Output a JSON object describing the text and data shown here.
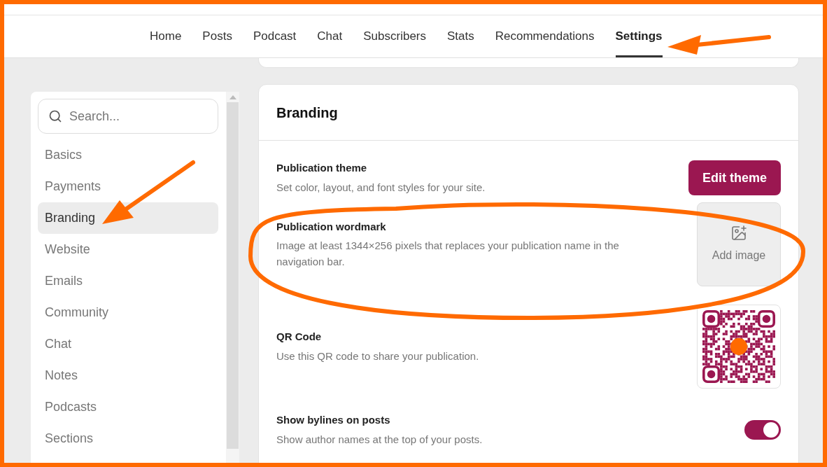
{
  "nav": {
    "tabs": [
      {
        "label": "Home",
        "selected": false
      },
      {
        "label": "Posts",
        "selected": false
      },
      {
        "label": "Podcast",
        "selected": false
      },
      {
        "label": "Chat",
        "selected": false
      },
      {
        "label": "Subscribers",
        "selected": false
      },
      {
        "label": "Stats",
        "selected": false
      },
      {
        "label": "Recommendations",
        "selected": false
      },
      {
        "label": "Settings",
        "selected": true
      }
    ]
  },
  "sidebar": {
    "search": {
      "placeholder": "Search..."
    },
    "items": [
      {
        "label": "Basics",
        "selected": false
      },
      {
        "label": "Payments",
        "selected": false
      },
      {
        "label": "Branding",
        "selected": true
      },
      {
        "label": "Website",
        "selected": false
      },
      {
        "label": "Emails",
        "selected": false
      },
      {
        "label": "Community",
        "selected": false
      },
      {
        "label": "Chat",
        "selected": false
      },
      {
        "label": "Notes",
        "selected": false
      },
      {
        "label": "Podcasts",
        "selected": false
      },
      {
        "label": "Sections",
        "selected": false
      }
    ]
  },
  "branding": {
    "title": "Branding",
    "rows": [
      {
        "kind": "button",
        "title": "Publication theme",
        "description": "Set color, layout, and font styles for your site.",
        "button": "Edit theme"
      },
      {
        "kind": "image_upload",
        "title": "Publication wordmark",
        "description": "Image at least 1344×256 pixels that replaces your publication name in the navigation bar.",
        "button": "Add image"
      },
      {
        "kind": "qr",
        "title": "QR Code",
        "description": "Use this QR code to share your publication."
      },
      {
        "kind": "toggle",
        "title": "Show bylines on posts",
        "description": "Show author names at the top of your posts.",
        "on": true
      }
    ]
  }
}
